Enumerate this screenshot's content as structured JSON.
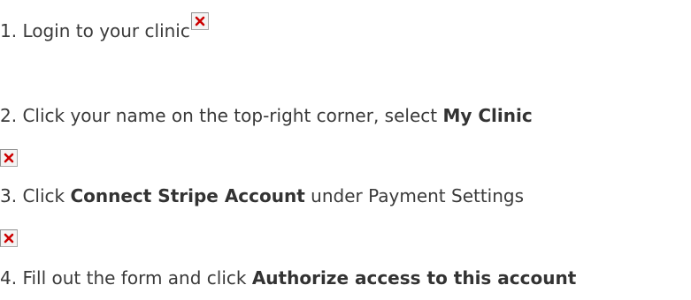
{
  "steps": [
    {
      "prefix": "1. Login to your clinic"
    },
    {
      "prefix": "2. Click your name on the top-right corner, select ",
      "bold": "My Clinic"
    },
    {
      "prefix": "3. Click ",
      "bold": "Connect Stripe Account",
      "suffix": " under Payment Settings"
    },
    {
      "prefix": "4. Fill out the form and click ",
      "bold": "Authorize access to this account"
    }
  ],
  "icons": {
    "broken_image": "broken-image-icon"
  },
  "colors": {
    "text": "#3a3a3a",
    "broken_image_x": "#cc0000"
  }
}
